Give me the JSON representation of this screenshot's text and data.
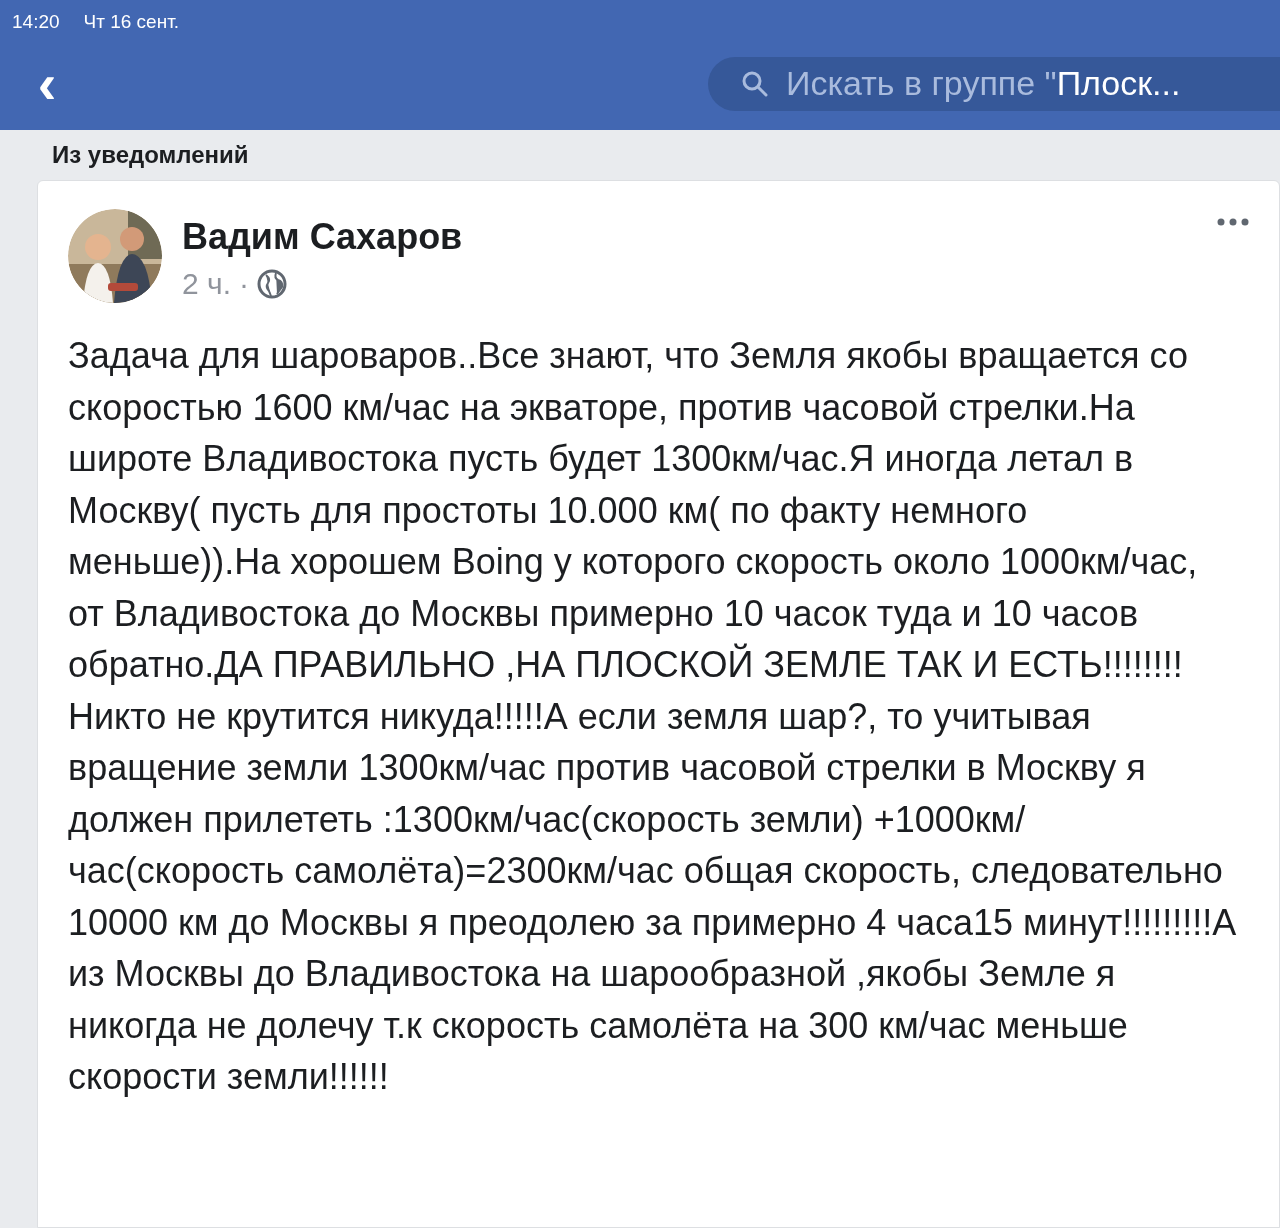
{
  "status_bar": {
    "time": "14:20",
    "date": "Чт 16 сент."
  },
  "header": {
    "back": "‹",
    "search": {
      "placeholder": "Искать в группе \"",
      "value": "Плоск..."
    }
  },
  "section_title": "Из уведомлений",
  "post": {
    "author": "Вадим Сахаров",
    "time": "2 ч.",
    "separator": "·",
    "text": "Задача для шароваров..Все знают, что Земля якобы вращается со скоростью 1600 км/час на экваторе, против часовой стрелки.На широте Владивостока пусть будет 1300км/час.Я иногда летал в Москву( пусть для простоты 10.000 км( по факту немного меньше)).На хорошем Boing у которого скорость около 1000км/час, от Владивостока до Москвы примерно 10 часок туда и 10 часов обратно.ДА ПРАВИЛЬНО ,НА ПЛОСКОЙ ЗЕМЛЕ ТАК И ЕСТЬ!!!!!!!! Никто не крутится никуда!!!!!А если земля шар?, то учитывая вращение земли 1300км/час против часовой стрелки в Москву я должен прилететь :1300км/час(скорость земли) +1000км/час(скорость самолёта)=2300км/час общая скорость, следовательно 10000 км до Москвы я преодолею за примерно 4 часа15 минут!!!!!!!!!А из Москвы до Владивостока на шарообразной ,якобы Земле я никогда не долечу т.к скорость самолёта на 300 км/час меньше скорости земли!!!!!!"
  }
}
